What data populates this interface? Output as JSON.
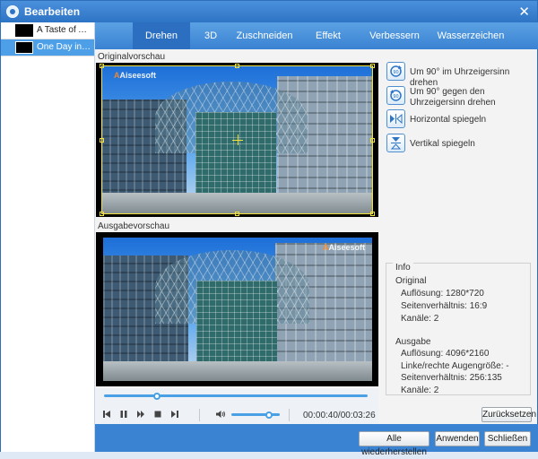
{
  "window": {
    "title": "Bearbeiten"
  },
  "files": [
    {
      "name": "A Taste of Aus...",
      "active": false
    },
    {
      "name": "One Day in Be...",
      "active": true
    }
  ],
  "tabs": [
    "Drehen",
    "3D",
    "Zuschneiden",
    "Effekt",
    "Verbessern",
    "Wasserzeichen"
  ],
  "active_tab": "Drehen",
  "preview": {
    "original_label": "Originalvorschau",
    "output_label": "Ausgabevorschau",
    "watermark": "Aiseesoft"
  },
  "player": {
    "progress": 0.2,
    "volume": 0.78,
    "time": "00:00:40/00:03:26"
  },
  "rotate": {
    "cw": "Um 90° im Uhrzeigersinn drehen",
    "ccw": "Um 90° gegen den Uhrzeigersinn drehen",
    "flip_h": "Horizontal spiegeln",
    "flip_v": "Vertikal spiegeln"
  },
  "info": {
    "legend": "Info",
    "original_heading": "Original",
    "original": {
      "resolution": "Auflösung: 1280*720",
      "aspect": "Seitenverhältnis: 16:9",
      "channels": "Kanäle: 2"
    },
    "output_heading": "Ausgabe",
    "output": {
      "resolution": "Auflösung: 4096*2160",
      "eye_size": "Linke/rechte Augengröße: -",
      "aspect": "Seitenverhältnis: 256:135",
      "channels": "Kanäle: 2"
    }
  },
  "buttons": {
    "reset": "Zurücksetzen",
    "restore_all": "Alle wiederherstellen",
    "apply": "Anwenden",
    "close": "Schließen"
  },
  "colors": {
    "accent": "#3a83d2",
    "crop_frame": "#f2e23a",
    "progress": "#4aa0e4"
  }
}
